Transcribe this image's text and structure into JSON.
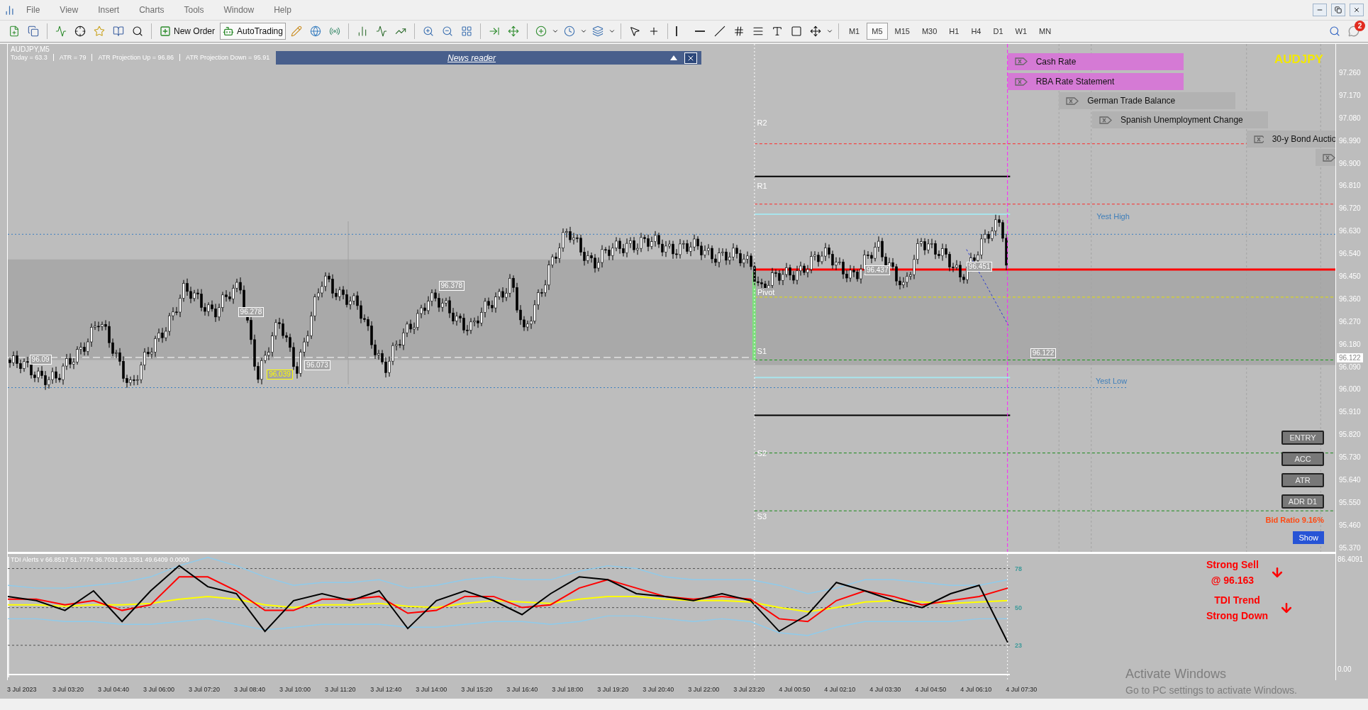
{
  "menu": [
    "File",
    "View",
    "Insert",
    "Charts",
    "Tools",
    "Window",
    "Help"
  ],
  "toolbar": {
    "buttons": [
      {
        "label": "New Order",
        "pressed": false
      },
      {
        "label": "AutoTrading",
        "pressed": true
      }
    ],
    "timeframes": [
      {
        "label": "M1",
        "selected": false
      },
      {
        "label": "M5",
        "selected": true
      },
      {
        "label": "M15",
        "selected": false
      },
      {
        "label": "M30",
        "selected": false
      },
      {
        "label": "H1",
        "selected": false
      },
      {
        "label": "H4",
        "selected": false
      },
      {
        "label": "D1",
        "selected": false
      },
      {
        "label": "W1",
        "selected": false
      },
      {
        "label": "MN",
        "selected": false
      }
    ],
    "notifications_badge": "2"
  },
  "chart": {
    "title": "AUDJPY,M5",
    "info": [
      "Today = 63.3",
      "ATR = 79",
      "ATR Projection Up = 96.86",
      "ATR Projection Down = 95.91"
    ],
    "news_reader": {
      "title": "News reader"
    },
    "symbol": "AUDJPY",
    "events": [
      {
        "label": "Cash Rate",
        "color": "#d57ad5"
      },
      {
        "label": "RBA Rate Statement",
        "color": "#d57ad5"
      },
      {
        "label": "German Trade Balance",
        "color": "#b2b2b2"
      },
      {
        "label": "Spanish Unemployment Change",
        "color": "#b2b2b2"
      },
      {
        "label": "30-y Bond Auctio",
        "color": "#b2b2b2"
      },
      {
        "color": "#b2b2b2"
      }
    ],
    "level_labels": [
      "R2",
      "R1",
      "Pivot",
      "S1",
      "S2",
      "S3",
      "Yest High",
      "Yest Low"
    ],
    "price_labels": [
      {
        "text": "96.09",
        "color": "#ffffff"
      },
      {
        "text": "96.278",
        "color": "#ffffff"
      },
      {
        "text": "96.039",
        "color": "#ffff00"
      },
      {
        "text": "96.073",
        "color": "#ffffff"
      },
      {
        "text": "96.378",
        "color": "#ffffff"
      },
      {
        "text": "96.437",
        "color": "#ffffff"
      },
      {
        "text": "96.451",
        "color": "#ffffff"
      },
      {
        "text": "96.122",
        "color": "#ffffff"
      }
    ],
    "price_axis": [
      "97.260",
      "97.170",
      "97.080",
      "96.990",
      "96.900",
      "96.810",
      "96.720",
      "96.630",
      "96.540",
      "96.450",
      "96.360",
      "96.270",
      "96.180",
      "96.090",
      "96.000",
      "95.910",
      "95.820",
      "95.730",
      "95.640",
      "95.550",
      "95.460",
      "95.370"
    ],
    "current_price": "96.122",
    "panel_buttons": [
      "ENTRY",
      "ACC",
      "ATR",
      "ADR D1"
    ],
    "bid_ratio": "Bid Ratio 9.16%",
    "show_button": "Show"
  },
  "indicator": {
    "title": "TDI Alerts v 66.8517 51.7774 36.7031 23.1351 49.6409 0.0000",
    "chart_data": {
      "type": "line",
      "grid": true,
      "ylim": [
        0,
        86.4091
      ],
      "yticks": [
        78,
        50,
        23
      ],
      "series": [
        {
          "color": "#8ecbec",
          "values": [
            66,
            64,
            64,
            66,
            68,
            72,
            80,
            86,
            80,
            72,
            66,
            68,
            68,
            70,
            64,
            66,
            70,
            72,
            70,
            70,
            76,
            80,
            78,
            72,
            70,
            70,
            70,
            66,
            60,
            64,
            70,
            70,
            68,
            66,
            66,
            70
          ]
        },
        {
          "color": "#8ecbec",
          "values": [
            42,
            42,
            40,
            40,
            38,
            38,
            40,
            42,
            38,
            34,
            36,
            38,
            38,
            38,
            36,
            36,
            38,
            40,
            40,
            38,
            40,
            44,
            44,
            42,
            40,
            42,
            40,
            32,
            30,
            36,
            40,
            40,
            40,
            40,
            42,
            42
          ]
        },
        {
          "color": "#ffff00",
          "values": [
            52,
            52,
            51,
            52,
            52,
            53,
            56,
            58,
            56,
            52,
            50,
            52,
            52,
            53,
            51,
            50,
            53,
            55,
            54,
            53,
            56,
            58,
            58,
            56,
            55,
            55,
            54,
            50,
            47,
            50,
            54,
            55,
            54,
            53,
            54,
            55
          ]
        },
        {
          "color": "#ff0000",
          "values": [
            56,
            56,
            52,
            55,
            48,
            52,
            72,
            72,
            62,
            48,
            48,
            56,
            56,
            58,
            46,
            48,
            58,
            58,
            50,
            52,
            64,
            70,
            64,
            58,
            56,
            58,
            56,
            42,
            40,
            55,
            62,
            58,
            52,
            55,
            58,
            64
          ]
        },
        {
          "color": "#000000",
          "values": [
            58,
            55,
            48,
            62,
            40,
            62,
            80,
            65,
            60,
            33,
            55,
            60,
            55,
            62,
            35,
            55,
            62,
            55,
            45,
            60,
            72,
            70,
            60,
            58,
            55,
            60,
            55,
            33,
            45,
            68,
            62,
            55,
            50,
            60,
            66,
            25
          ]
        }
      ]
    },
    "axis": [
      "86.4091",
      "0.00"
    ],
    "signals": [
      {
        "lines": [
          "Strong Sell",
          "@ 96.163"
        ]
      },
      {
        "lines": [
          "TDI Trend",
          "Strong Down"
        ]
      }
    ]
  },
  "time_axis": [
    "3 Jul 2023",
    "3 Jul 03:20",
    "3 Jul 04:40",
    "3 Jul 06:00",
    "3 Jul 07:20",
    "3 Jul 08:40",
    "3 Jul 10:00",
    "3 Jul 11:20",
    "3 Jul 12:40",
    "3 Jul 14:00",
    "3 Jul 15:20",
    "3 Jul 16:40",
    "3 Jul 18:00",
    "3 Jul 19:20",
    "3 Jul 20:40",
    "3 Jul 22:00",
    "3 Jul 23:20",
    "4 Jul 00:50",
    "4 Jul 02:10",
    "4 Jul 03:30",
    "4 Jul 04:50",
    "4 Jul 06:10",
    "4 Jul 07:30"
  ],
  "os_notice": [
    "Activate Windows",
    "Go to PC settings to activate Windows."
  ]
}
